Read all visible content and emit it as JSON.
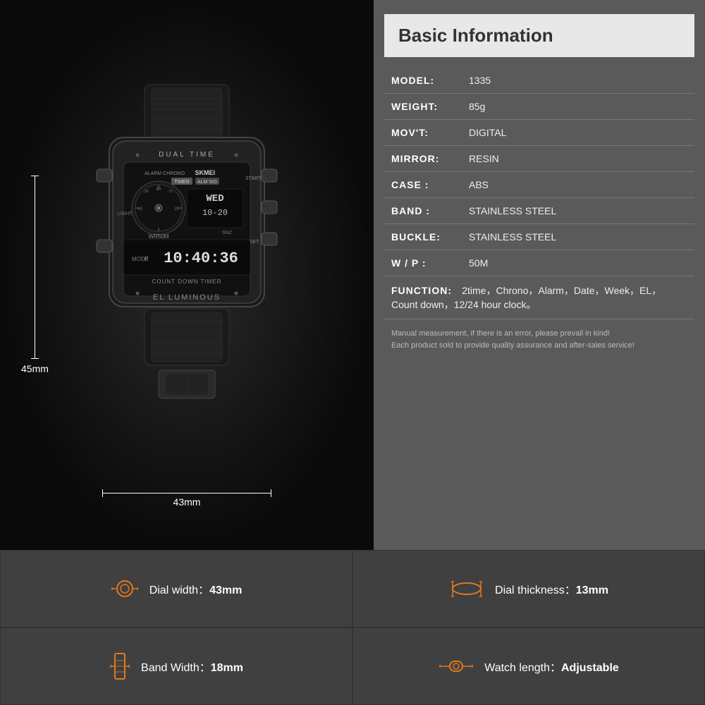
{
  "page": {
    "background": "#111"
  },
  "watch": {
    "brand": "SKMEI",
    "model_text": "DUAL TIME",
    "features": [
      "ALARM CHRONO",
      "TIMER",
      "ALM SIG",
      "WR50M",
      "EL LUMINOUS",
      "COUNT DOWN TIMER"
    ],
    "time_display": "10:40:36",
    "date_display": "10-20",
    "day_display": "WED",
    "dim_height": "45mm",
    "dim_width": "43mm"
  },
  "info_panel": {
    "title": "Basic Information",
    "rows": [
      {
        "label": "MODEL:",
        "value": "1335"
      },
      {
        "label": "WEIGHT:",
        "value": "85g"
      },
      {
        "label": "MOV'T:",
        "value": "DIGITAL"
      },
      {
        "label": "MIRROR:",
        "value": "RESIN"
      },
      {
        "label": "CASE:",
        "value": "ABS"
      },
      {
        "label": "BAND:",
        "value": "STAINLESS STEEL"
      },
      {
        "label": "BUCKLE:",
        "value": "STAINLESS STEEL"
      },
      {
        "label": "W / P :",
        "value": "50M"
      }
    ],
    "function_label": "FUNCTION:",
    "function_value": "2time，Chrono，Alarm，Date，Week，EL，Count down，12/24 hour clock。",
    "note_line1": "Manual measurement, if there is an error, please prevail in kind!",
    "note_line2": "Each product sold to provide quality assurance and after-sales service!"
  },
  "specs": {
    "dial_width_label": "Dial width：",
    "dial_width_value": "43mm",
    "dial_thickness_label": "Dial thickness：",
    "dial_thickness_value": "13mm",
    "band_width_label": "Band Width：",
    "band_width_value": "18mm",
    "watch_length_label": "Watch length：",
    "watch_length_value": "Adjustable"
  }
}
